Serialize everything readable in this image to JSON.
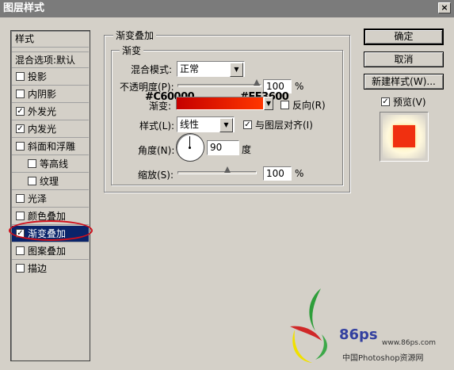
{
  "window": {
    "title": "图层样式",
    "close_glyph": "×"
  },
  "style_list": {
    "header": "样式",
    "items": [
      {
        "label": "混合选项:默认",
        "checkbox": false,
        "checked": false
      },
      {
        "label": "投影",
        "checkbox": true,
        "checked": false
      },
      {
        "label": "内阴影",
        "checkbox": true,
        "checked": false
      },
      {
        "label": "外发光",
        "checkbox": true,
        "checked": true
      },
      {
        "label": "内发光",
        "checkbox": true,
        "checked": true
      },
      {
        "label": "斜面和浮雕",
        "checkbox": true,
        "checked": false
      },
      {
        "label": "等高线",
        "checkbox": true,
        "checked": false
      },
      {
        "label": "纹理",
        "checkbox": true,
        "checked": false
      },
      {
        "label": "光泽",
        "checkbox": true,
        "checked": false
      },
      {
        "label": "颜色叠加",
        "checkbox": true,
        "checked": false
      },
      {
        "label": "渐变叠加",
        "checkbox": true,
        "checked": true,
        "selected": true
      },
      {
        "label": "图案叠加",
        "checkbox": true,
        "checked": false
      },
      {
        "label": "描边",
        "checkbox": true,
        "checked": false
      }
    ]
  },
  "panel": {
    "group_title": "渐变叠加",
    "subgroup_title": "渐变",
    "blend_mode": {
      "label": "混合模式:",
      "value": "正常"
    },
    "opacity": {
      "label": "不透明度(P):",
      "value": "100",
      "unit": "%",
      "level": 100
    },
    "gradient": {
      "label": "渐变:",
      "start_color": "#C60000",
      "end_color": "#FF3600",
      "reverse_label": "反向(R)",
      "reverse_checked": false
    },
    "style": {
      "label": "样式(L):",
      "value": "线性",
      "align_label": "与图层对齐(I)",
      "align_checked": true
    },
    "angle": {
      "label": "角度(N):",
      "value": "90",
      "unit": "度"
    },
    "scale": {
      "label": "缩放(S):",
      "value": "100",
      "unit": "%",
      "level": 100
    }
  },
  "buttons": {
    "ok": "确定",
    "cancel": "取消",
    "new_style": "新建样式(W)...",
    "preview_label": "预览(V)",
    "preview_checked": true
  },
  "watermark": {
    "brand": "86ps",
    "url": "www.86ps.com",
    "site": "中国Photoshop资源网"
  },
  "colors": {
    "accent": "#0a246a",
    "highlight_ellipse": "#d0101c"
  }
}
